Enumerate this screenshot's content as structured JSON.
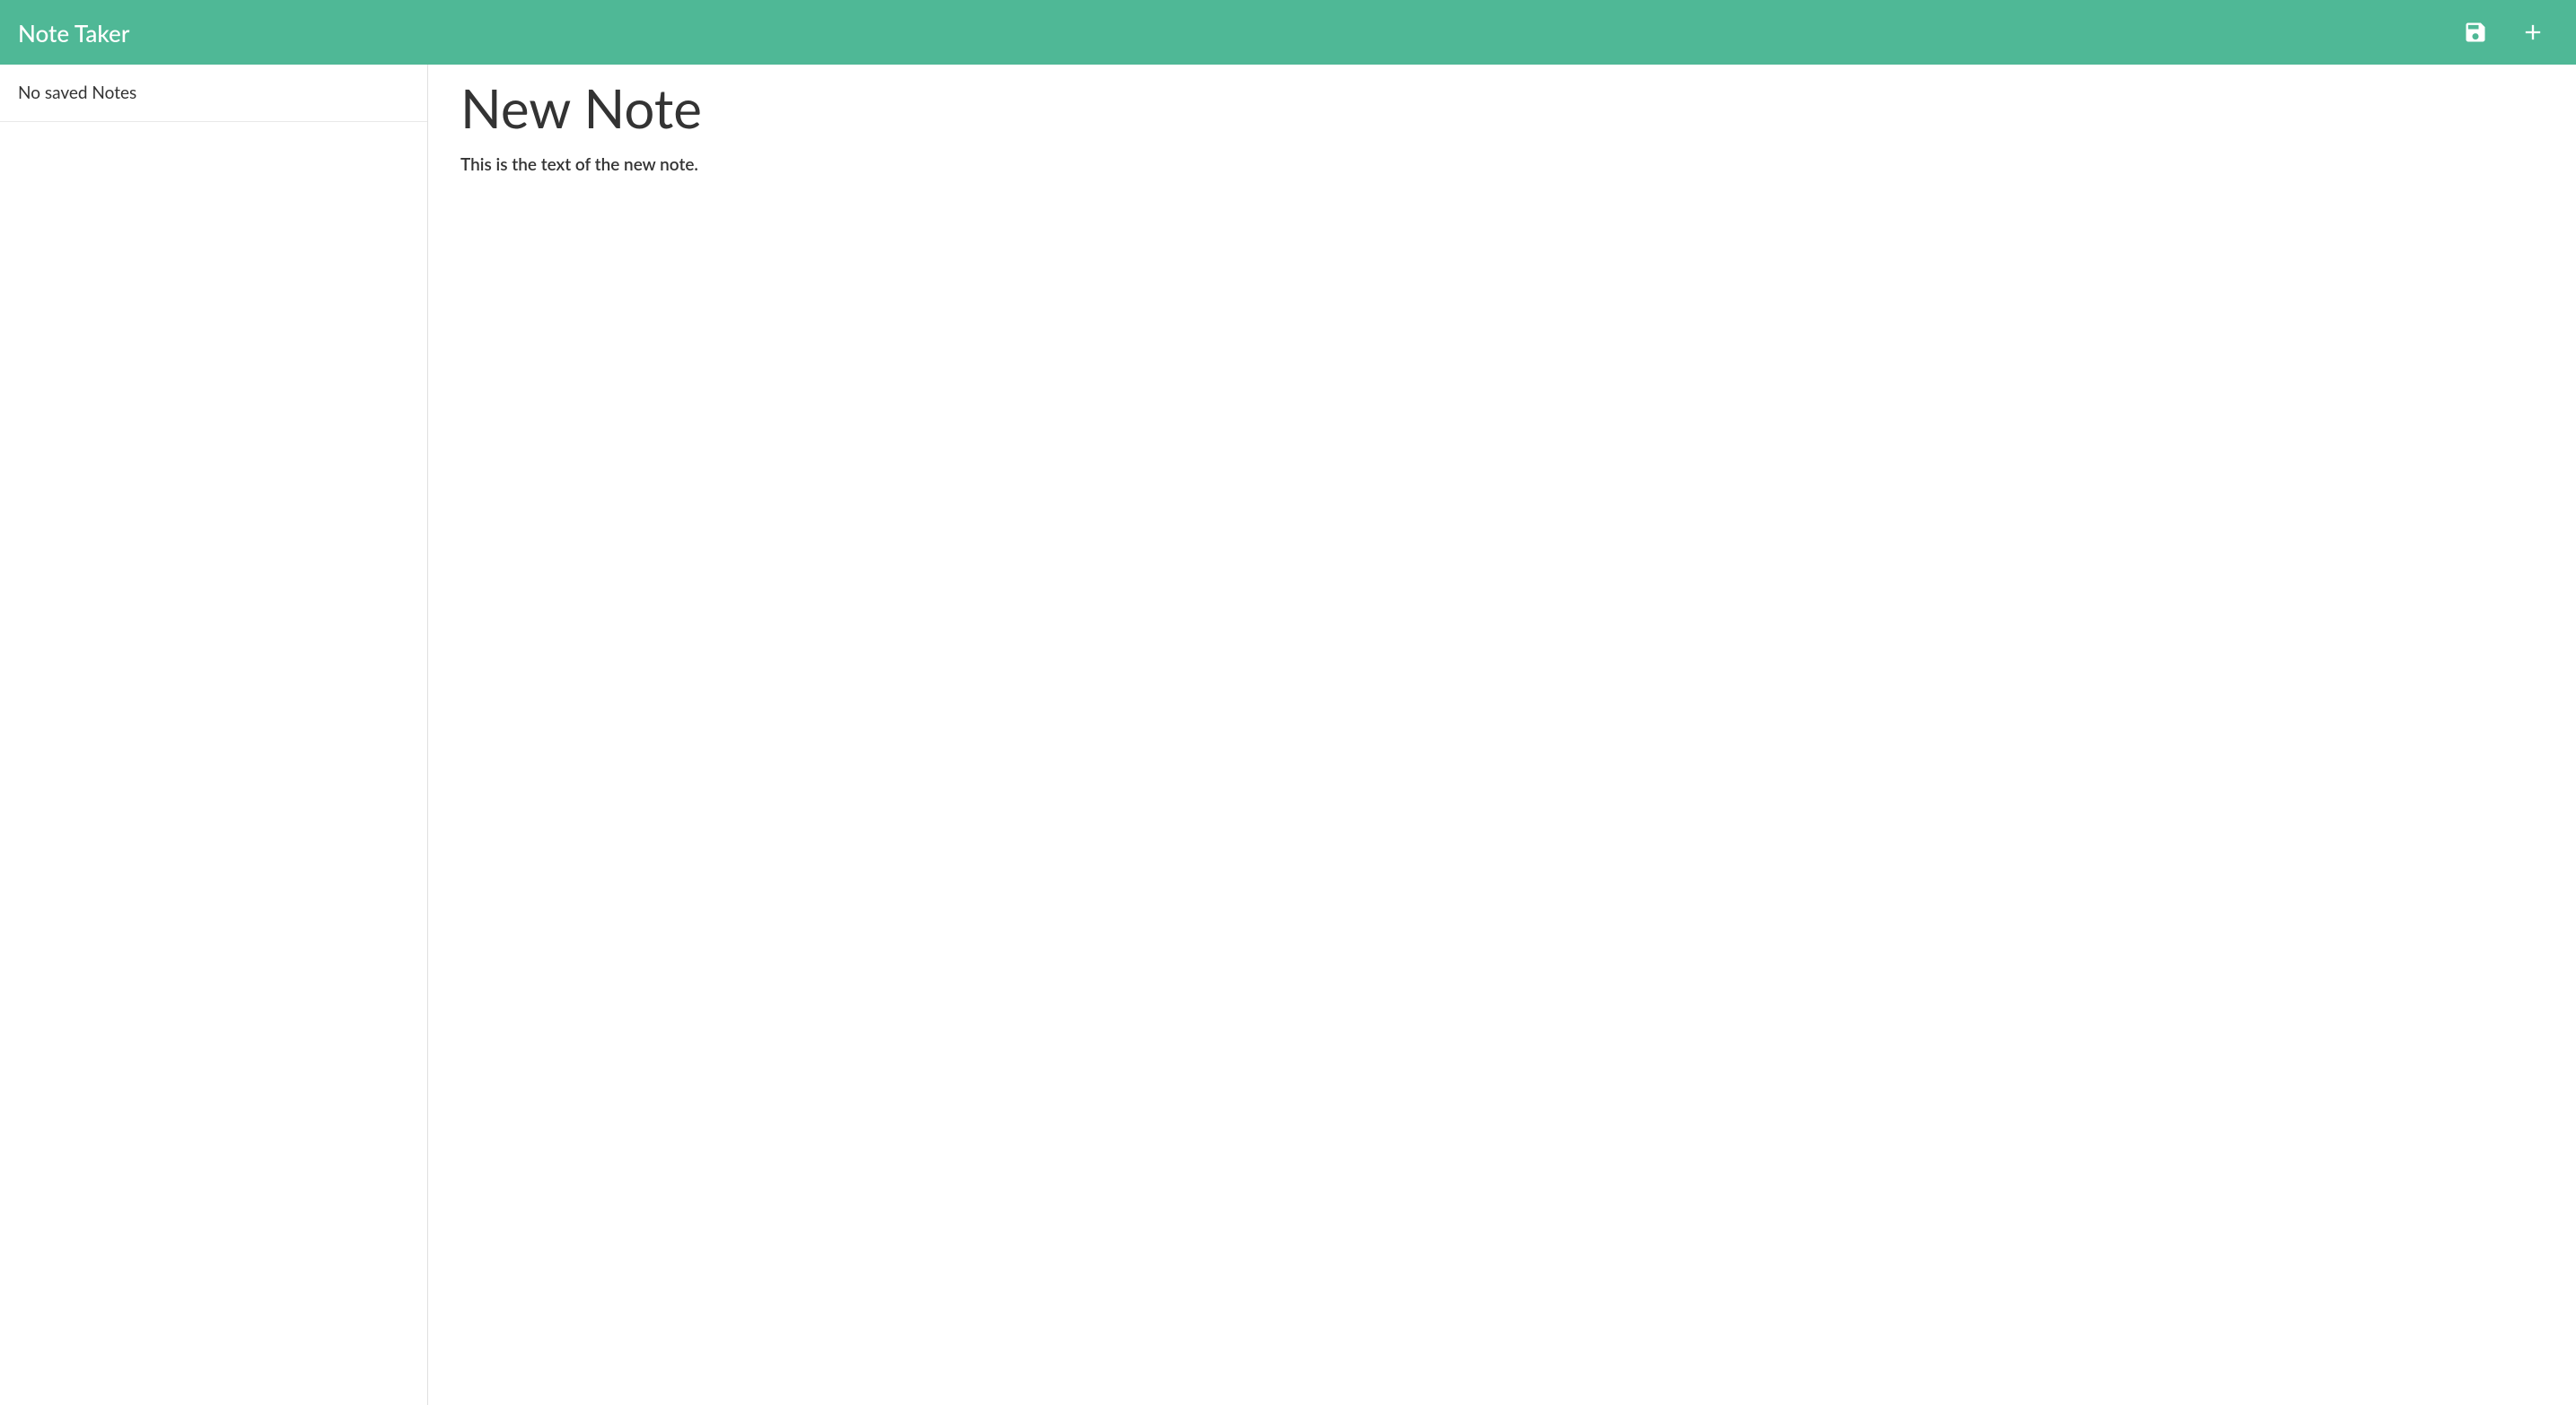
{
  "header": {
    "title": "Note Taker",
    "save_icon": "save-icon",
    "add_icon": "plus-icon"
  },
  "sidebar": {
    "empty_message": "No saved Notes"
  },
  "note": {
    "title": "New Note",
    "body": "This is the text of the new note."
  },
  "colors": {
    "accent": "#4fb896",
    "text": "#333333",
    "border": "#e0e0e0"
  }
}
